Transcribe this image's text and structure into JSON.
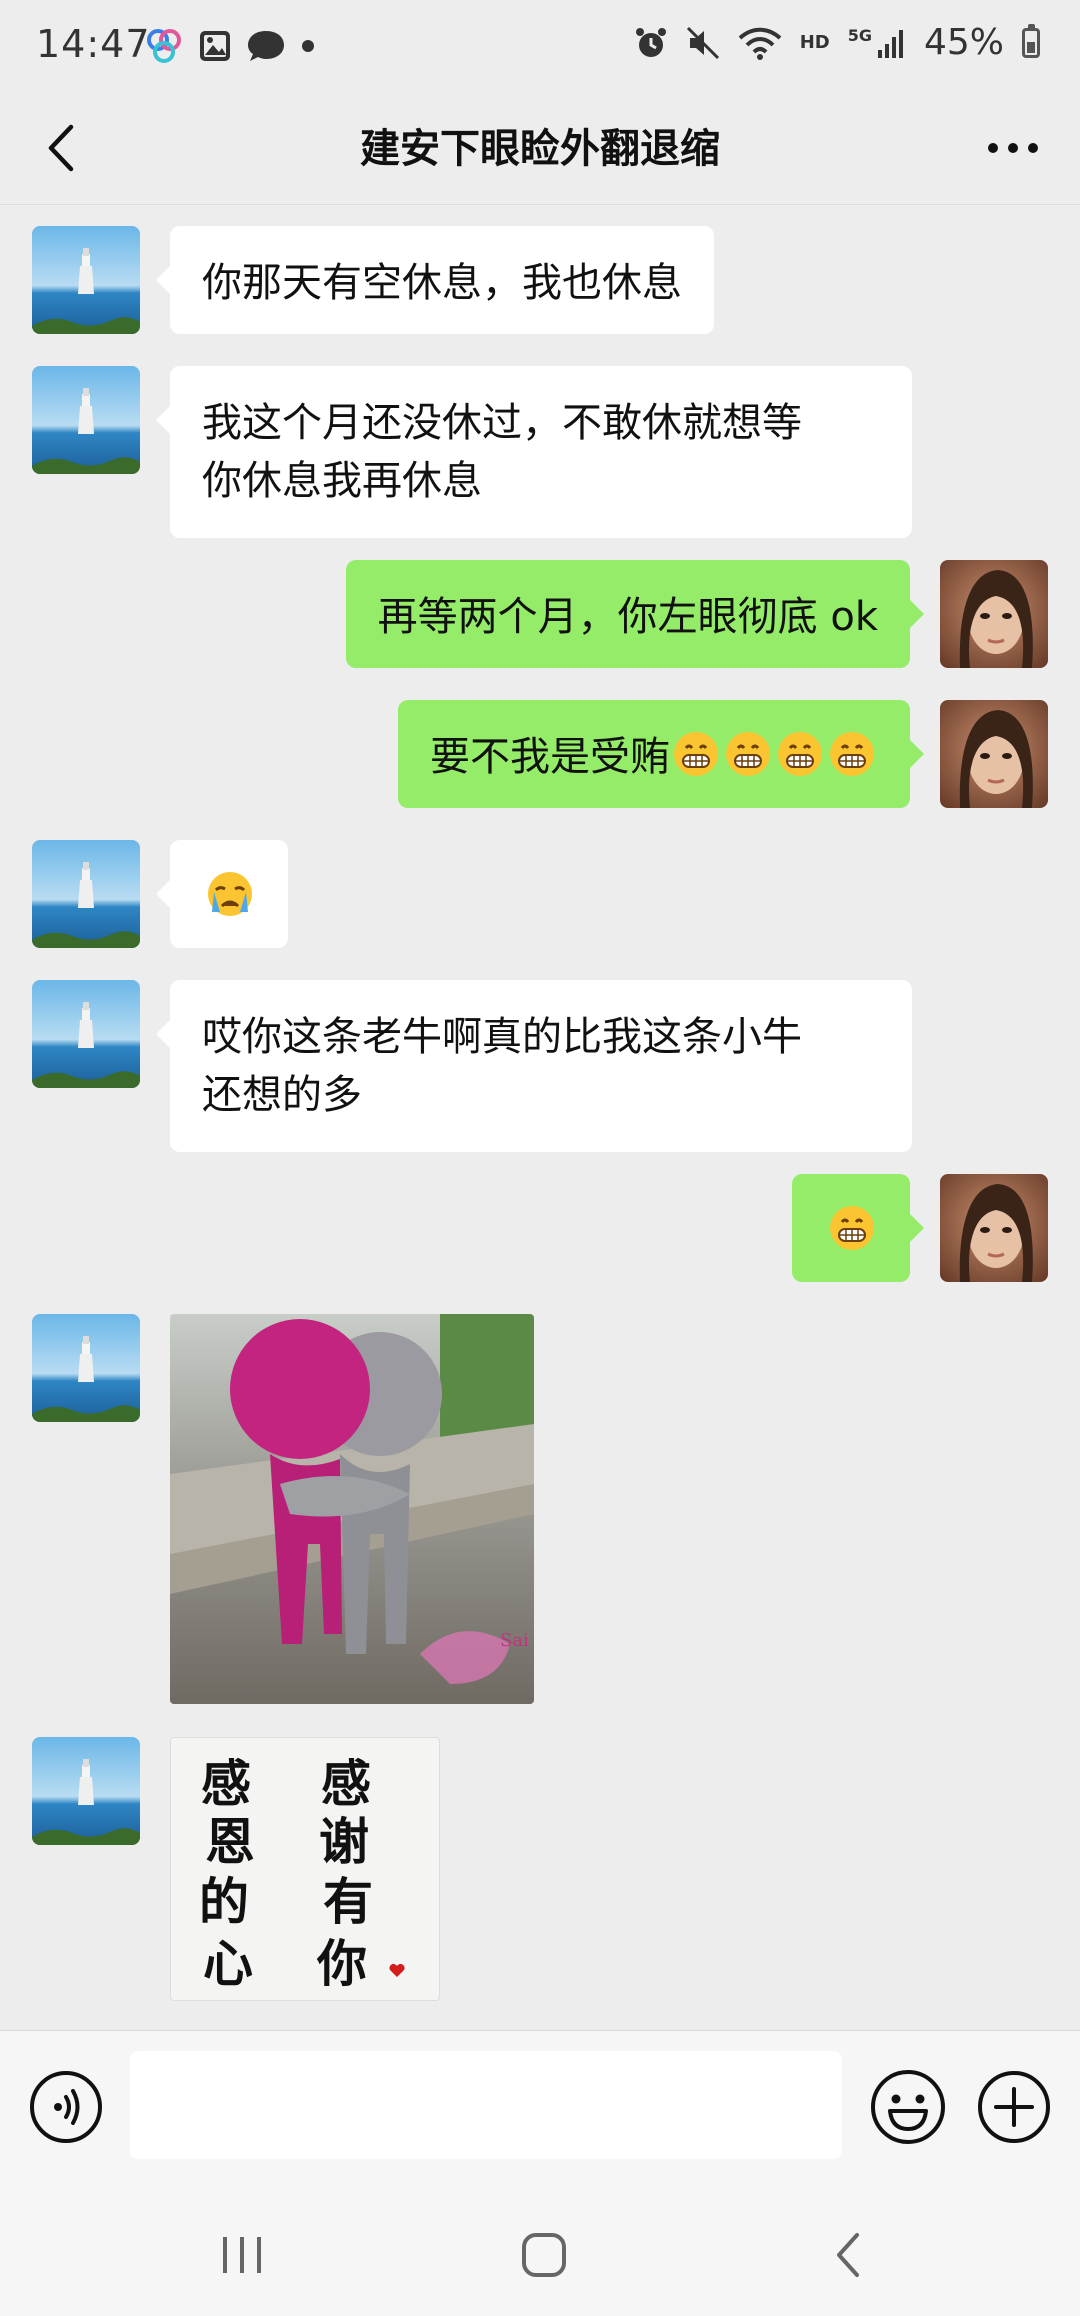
{
  "status_bar": {
    "time": "14:47",
    "battery": "45%",
    "network": "HD",
    "signal": "5G"
  },
  "header": {
    "title": "建安下眼睑外翻退缩"
  },
  "messages": [
    {
      "side": "in",
      "text": "你那天有空休息，我也休息"
    },
    {
      "side": "in",
      "text_line1": "我这个月还没休过，不敢休就想等",
      "text_line2": "你休息我再休息"
    },
    {
      "side": "out",
      "text": "再等两个月，你左眼彻底 ok"
    },
    {
      "side": "out",
      "text": "要不我是受贿",
      "emoji": "grin-emoji",
      "emoji_count": 4
    },
    {
      "side": "in",
      "emoji": "crying-emoji"
    },
    {
      "side": "in",
      "text_line1": "哎你这条老牛啊真的比我这条小牛",
      "text_line2": "还想的多"
    },
    {
      "side": "out",
      "emoji": "grin-emoji"
    },
    {
      "side": "in",
      "image": "crochet-dolls-hug-sticker",
      "image_caption": "Sai"
    },
    {
      "side": "in",
      "image": "calligraphy-sticker",
      "calligraphy": [
        "感",
        "恩",
        "的",
        "心",
        "感",
        "谢",
        "有",
        "你"
      ]
    }
  ],
  "input_bar": {
    "placeholder": ""
  },
  "colors": {
    "background": "#ededed",
    "bubble_in": "#ffffff",
    "bubble_out": "#95ec69"
  }
}
